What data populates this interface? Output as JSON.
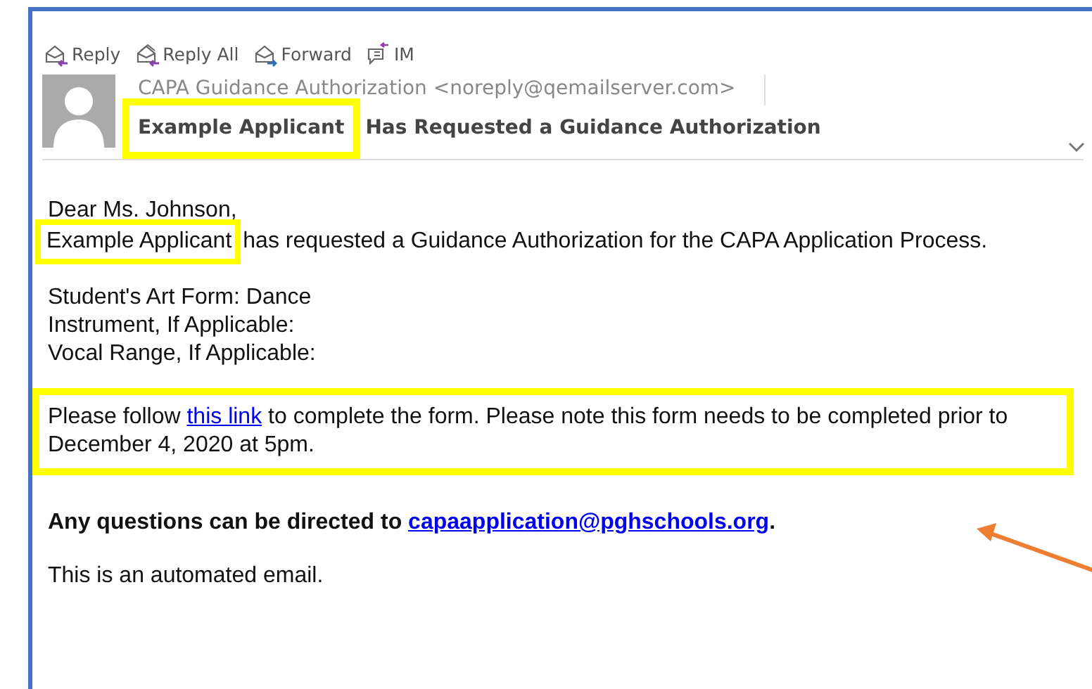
{
  "toolbar": [
    {
      "kind": "reply",
      "label": "Reply"
    },
    {
      "kind": "reply_all",
      "label": "Reply All"
    },
    {
      "kind": "forward",
      "label": "Forward"
    },
    {
      "kind": "im",
      "label": "IM"
    }
  ],
  "header": {
    "sender": "CAPA Guidance Authorization <noreply@qemailserver.com>",
    "subject_highlight": "Example Applicant",
    "subject_rest": "Has Requested a Guidance Authorization"
  },
  "body": {
    "greeting": "Dear Ms. Johnson,",
    "applicant": "Example Applicant",
    "request_rest": "has requested a Guidance Authorization for the CAPA Application Process.",
    "fields": [
      "Student's Art Form: Dance",
      "Instrument, If Applicable:",
      "Vocal Range, If Applicable:"
    ],
    "follow_before": "Please follow ",
    "follow_link": "this link",
    "follow_after": " to complete the form. Please note this form needs to be completed prior to December 4, 2020 at 5pm.",
    "questions_text": "Any questions can be directed to ",
    "questions_email": "capaapplication@pghschools.org",
    "questions_end": ".",
    "automated": "This is an automated email."
  }
}
